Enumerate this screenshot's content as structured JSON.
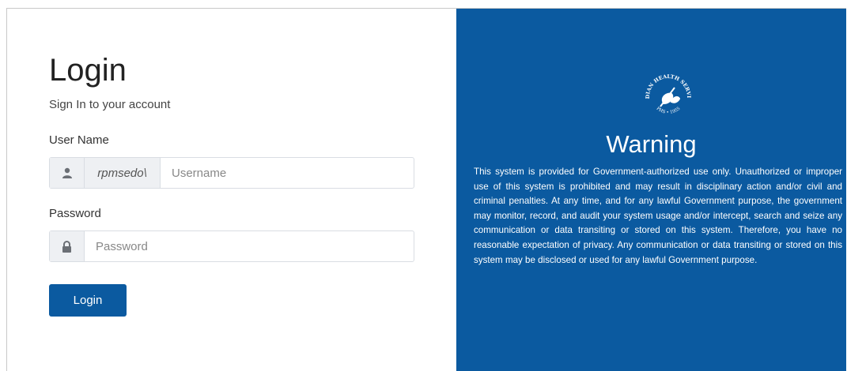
{
  "login": {
    "title": "Login",
    "subtitle": "Sign In to your account",
    "username_label": "User Name",
    "domain_prefix": "rpmsedo\\",
    "username_placeholder": "Username",
    "password_label": "Password",
    "password_placeholder": "Password",
    "button_label": "Login",
    "icons": {
      "user": "user-icon",
      "lock": "lock-icon"
    }
  },
  "warning": {
    "seal_top_text": "INDIAN HEALTH SERVICE",
    "seal_bottom_text": "PHS • 1955",
    "title": "Warning",
    "body": "This system is provided for Government-authorized use only. Unauthorized or improper use of this system is prohibited and may result in disciplinary action and/or civil and criminal penalties. At any time, and for any lawful Government purpose, the government may monitor, record, and audit your system usage and/or intercept, search and seize any communication or data transiting or stored on this system. Therefore, you have no reasonable expectation of privacy. Any communication or data transiting or stored on this system may be disclosed or used for any lawful Government purpose."
  },
  "colors": {
    "brand_blue": "#0b5aa0",
    "border": "#d9dde3",
    "addon_bg": "#eef0f3"
  }
}
